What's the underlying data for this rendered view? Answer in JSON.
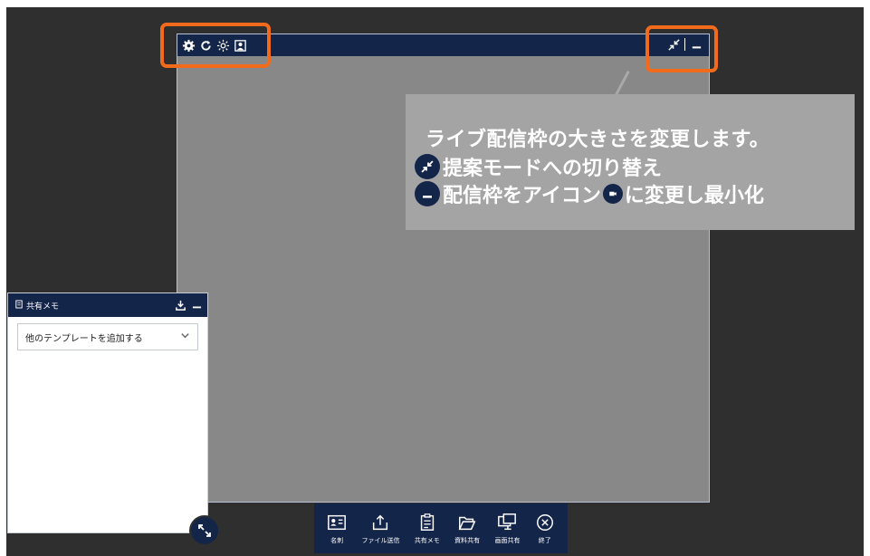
{
  "tooltip": {
    "title": "ライブ配信枠の大きさを変更します。",
    "line1": "提案モードへの切り替え",
    "line2_a": "配信枠をアイコン",
    "line2_b": "に変更し最小化"
  },
  "memo": {
    "title": "共有メモ",
    "select_value": "他のテンプレートを追加する"
  },
  "toolbar": {
    "items": [
      {
        "label": "名刺",
        "icon": "business-card-icon"
      },
      {
        "label": "ファイル送信",
        "icon": "file-upload-icon"
      },
      {
        "label": "共有メモ",
        "icon": "memo-icon"
      },
      {
        "label": "資料共有",
        "icon": "document-share-icon"
      },
      {
        "label": "画面共有",
        "icon": "screen-share-icon"
      },
      {
        "label": "終了",
        "icon": "close-circle-icon"
      }
    ]
  },
  "colors": {
    "navy": "#14254a",
    "highlight": "#f26b1d",
    "stream_bg": "#888888",
    "tooltip_bg": "#a4a4a4"
  }
}
